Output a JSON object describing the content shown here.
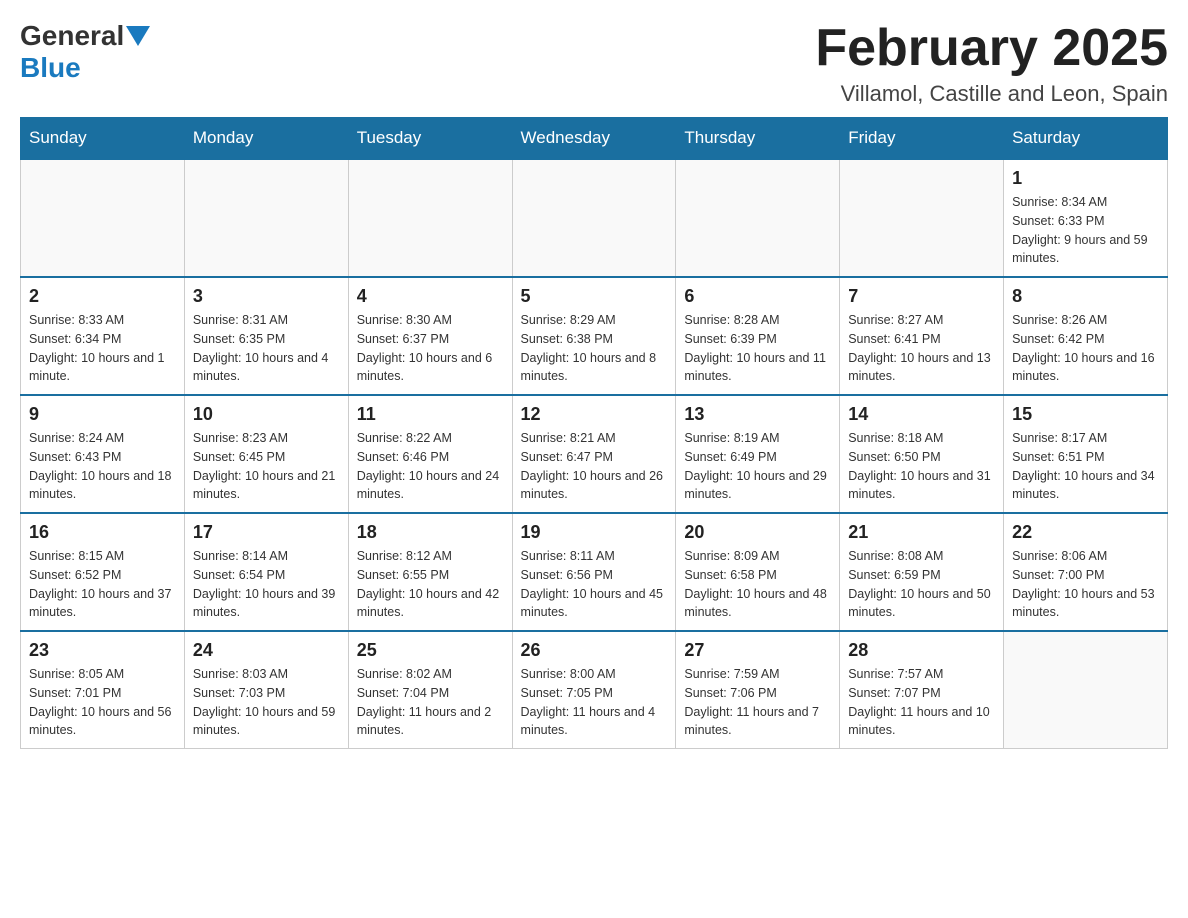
{
  "header": {
    "logo_general": "General",
    "logo_blue": "Blue",
    "month_year": "February 2025",
    "location": "Villamol, Castille and Leon, Spain"
  },
  "weekdays": [
    "Sunday",
    "Monday",
    "Tuesday",
    "Wednesday",
    "Thursday",
    "Friday",
    "Saturday"
  ],
  "weeks": [
    [
      {
        "day": "",
        "info": ""
      },
      {
        "day": "",
        "info": ""
      },
      {
        "day": "",
        "info": ""
      },
      {
        "day": "",
        "info": ""
      },
      {
        "day": "",
        "info": ""
      },
      {
        "day": "",
        "info": ""
      },
      {
        "day": "1",
        "info": "Sunrise: 8:34 AM\nSunset: 6:33 PM\nDaylight: 9 hours and 59 minutes."
      }
    ],
    [
      {
        "day": "2",
        "info": "Sunrise: 8:33 AM\nSunset: 6:34 PM\nDaylight: 10 hours and 1 minute."
      },
      {
        "day": "3",
        "info": "Sunrise: 8:31 AM\nSunset: 6:35 PM\nDaylight: 10 hours and 4 minutes."
      },
      {
        "day": "4",
        "info": "Sunrise: 8:30 AM\nSunset: 6:37 PM\nDaylight: 10 hours and 6 minutes."
      },
      {
        "day": "5",
        "info": "Sunrise: 8:29 AM\nSunset: 6:38 PM\nDaylight: 10 hours and 8 minutes."
      },
      {
        "day": "6",
        "info": "Sunrise: 8:28 AM\nSunset: 6:39 PM\nDaylight: 10 hours and 11 minutes."
      },
      {
        "day": "7",
        "info": "Sunrise: 8:27 AM\nSunset: 6:41 PM\nDaylight: 10 hours and 13 minutes."
      },
      {
        "day": "8",
        "info": "Sunrise: 8:26 AM\nSunset: 6:42 PM\nDaylight: 10 hours and 16 minutes."
      }
    ],
    [
      {
        "day": "9",
        "info": "Sunrise: 8:24 AM\nSunset: 6:43 PM\nDaylight: 10 hours and 18 minutes."
      },
      {
        "day": "10",
        "info": "Sunrise: 8:23 AM\nSunset: 6:45 PM\nDaylight: 10 hours and 21 minutes."
      },
      {
        "day": "11",
        "info": "Sunrise: 8:22 AM\nSunset: 6:46 PM\nDaylight: 10 hours and 24 minutes."
      },
      {
        "day": "12",
        "info": "Sunrise: 8:21 AM\nSunset: 6:47 PM\nDaylight: 10 hours and 26 minutes."
      },
      {
        "day": "13",
        "info": "Sunrise: 8:19 AM\nSunset: 6:49 PM\nDaylight: 10 hours and 29 minutes."
      },
      {
        "day": "14",
        "info": "Sunrise: 8:18 AM\nSunset: 6:50 PM\nDaylight: 10 hours and 31 minutes."
      },
      {
        "day": "15",
        "info": "Sunrise: 8:17 AM\nSunset: 6:51 PM\nDaylight: 10 hours and 34 minutes."
      }
    ],
    [
      {
        "day": "16",
        "info": "Sunrise: 8:15 AM\nSunset: 6:52 PM\nDaylight: 10 hours and 37 minutes."
      },
      {
        "day": "17",
        "info": "Sunrise: 8:14 AM\nSunset: 6:54 PM\nDaylight: 10 hours and 39 minutes."
      },
      {
        "day": "18",
        "info": "Sunrise: 8:12 AM\nSunset: 6:55 PM\nDaylight: 10 hours and 42 minutes."
      },
      {
        "day": "19",
        "info": "Sunrise: 8:11 AM\nSunset: 6:56 PM\nDaylight: 10 hours and 45 minutes."
      },
      {
        "day": "20",
        "info": "Sunrise: 8:09 AM\nSunset: 6:58 PM\nDaylight: 10 hours and 48 minutes."
      },
      {
        "day": "21",
        "info": "Sunrise: 8:08 AM\nSunset: 6:59 PM\nDaylight: 10 hours and 50 minutes."
      },
      {
        "day": "22",
        "info": "Sunrise: 8:06 AM\nSunset: 7:00 PM\nDaylight: 10 hours and 53 minutes."
      }
    ],
    [
      {
        "day": "23",
        "info": "Sunrise: 8:05 AM\nSunset: 7:01 PM\nDaylight: 10 hours and 56 minutes."
      },
      {
        "day": "24",
        "info": "Sunrise: 8:03 AM\nSunset: 7:03 PM\nDaylight: 10 hours and 59 minutes."
      },
      {
        "day": "25",
        "info": "Sunrise: 8:02 AM\nSunset: 7:04 PM\nDaylight: 11 hours and 2 minutes."
      },
      {
        "day": "26",
        "info": "Sunrise: 8:00 AM\nSunset: 7:05 PM\nDaylight: 11 hours and 4 minutes."
      },
      {
        "day": "27",
        "info": "Sunrise: 7:59 AM\nSunset: 7:06 PM\nDaylight: 11 hours and 7 minutes."
      },
      {
        "day": "28",
        "info": "Sunrise: 7:57 AM\nSunset: 7:07 PM\nDaylight: 11 hours and 10 minutes."
      },
      {
        "day": "",
        "info": ""
      }
    ]
  ]
}
